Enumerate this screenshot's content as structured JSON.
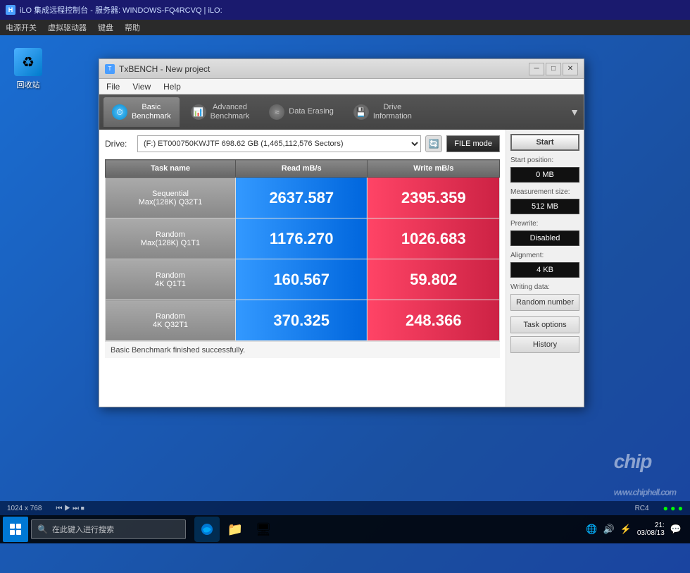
{
  "topbar": {
    "icon": "iLO",
    "title": "iLO 集成远程控制台 - 服务器: WINDOWS-FQ4RCVQ | iLO:",
    "menus": [
      "电源开关",
      "虚拟驱动器",
      "键盘",
      "帮助"
    ]
  },
  "desktop": {
    "recycle_bin_label": "回收站"
  },
  "window": {
    "title": "TxBENCH - New project",
    "menus": [
      "File",
      "View",
      "Help"
    ],
    "tabs": [
      {
        "label": "Basic\nBenchmark",
        "active": true,
        "icon": "⏱"
      },
      {
        "label": "Advanced\nBenchmark",
        "active": false,
        "icon": "📊"
      },
      {
        "label": "Data Erasing",
        "active": false,
        "icon": "≈"
      },
      {
        "label": "Drive\nInformation",
        "active": false,
        "icon": "💾"
      }
    ],
    "drive_label": "Drive:",
    "drive_value": "(F:) ET000750KWJTF  698.62 GB (1,465,112,576 Sectors)",
    "file_mode_label": "FILE mode",
    "table": {
      "headers": [
        "Task name",
        "Read mB/s",
        "Write mB/s"
      ],
      "rows": [
        {
          "task": "Sequential\nMax(128K) Q32T1",
          "read": "2637.587",
          "write": "2395.359"
        },
        {
          "task": "Random\nMax(128K) Q1T1",
          "read": "1176.270",
          "write": "1026.683"
        },
        {
          "task": "Random\n4K Q1T1",
          "read": "160.567",
          "write": "59.802"
        },
        {
          "task": "Random\n4K Q32T1",
          "read": "370.325",
          "write": "248.366"
        }
      ]
    },
    "status": "Basic Benchmark finished successfully.",
    "sidebar": {
      "start_label": "Start",
      "start_position_label": "Start position:",
      "start_position_value": "0 MB",
      "measurement_size_label": "Measurement size:",
      "measurement_size_value": "512 MB",
      "prewrite_label": "Prewrite:",
      "prewrite_value": "Disabled",
      "alignment_label": "Alignment:",
      "alignment_value": "4 KB",
      "writing_data_label": "Writing data:",
      "writing_data_value": "Random number",
      "task_options_label": "Task options",
      "history_label": "History"
    }
  },
  "taskbar": {
    "search_placeholder": "在此键入进行搜索",
    "time": "21:",
    "date": "03/08/13",
    "rc4_label": "RC4",
    "resolution": "1024 x 768"
  }
}
